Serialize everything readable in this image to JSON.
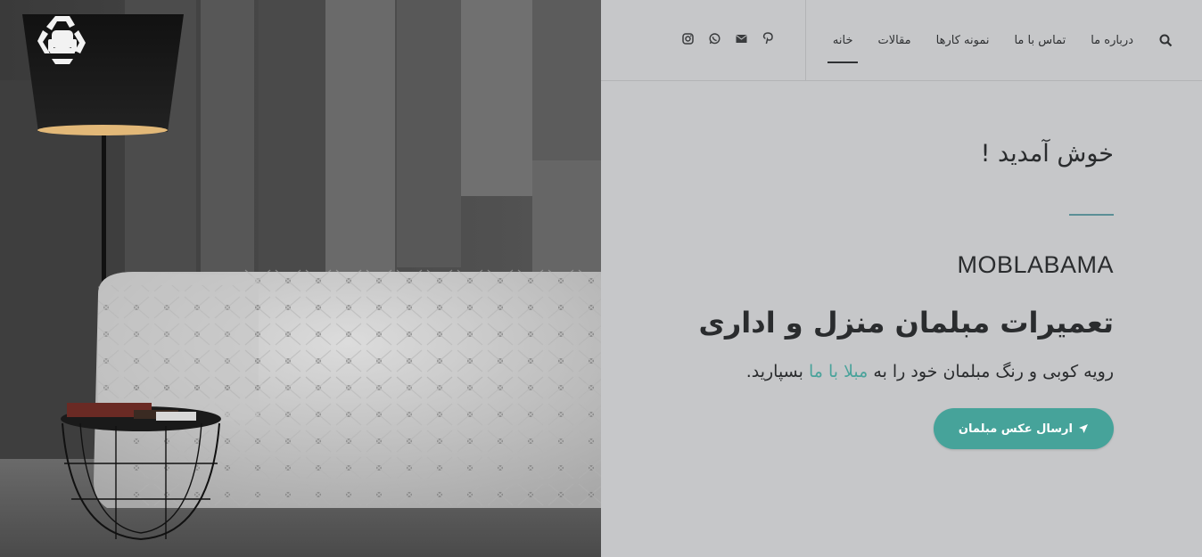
{
  "nav": {
    "items": [
      {
        "label": "خانه",
        "active": true
      },
      {
        "label": "مقالات",
        "active": false
      },
      {
        "label": "نمونه کارها",
        "active": false
      },
      {
        "label": "تماس با ما",
        "active": false
      },
      {
        "label": "درباره ما",
        "active": false
      }
    ]
  },
  "icons": {
    "search": "search-icon",
    "socials": [
      "instagram-icon",
      "whatsapp-icon",
      "email-icon",
      "pinterest-icon"
    ],
    "logo": "recycle-sofa-logo"
  },
  "hero": {
    "welcome": "خوش آمدید !",
    "brand": "MOBLABAMA",
    "headline": "تعمیرات مبلمان منزل و اداری",
    "tagline_before": "رویه کوبی و رنگ مبلمان خود را به ",
    "tagline_link": "مبلا با ما",
    "tagline_after": " بسپارید.",
    "cta_label": "ارسال عکس مبلمان"
  },
  "colors": {
    "accent": "#46a39a",
    "panel_bg": "#c6c7c9",
    "text": "#2a2c2e",
    "rule": "#5b8f96"
  }
}
